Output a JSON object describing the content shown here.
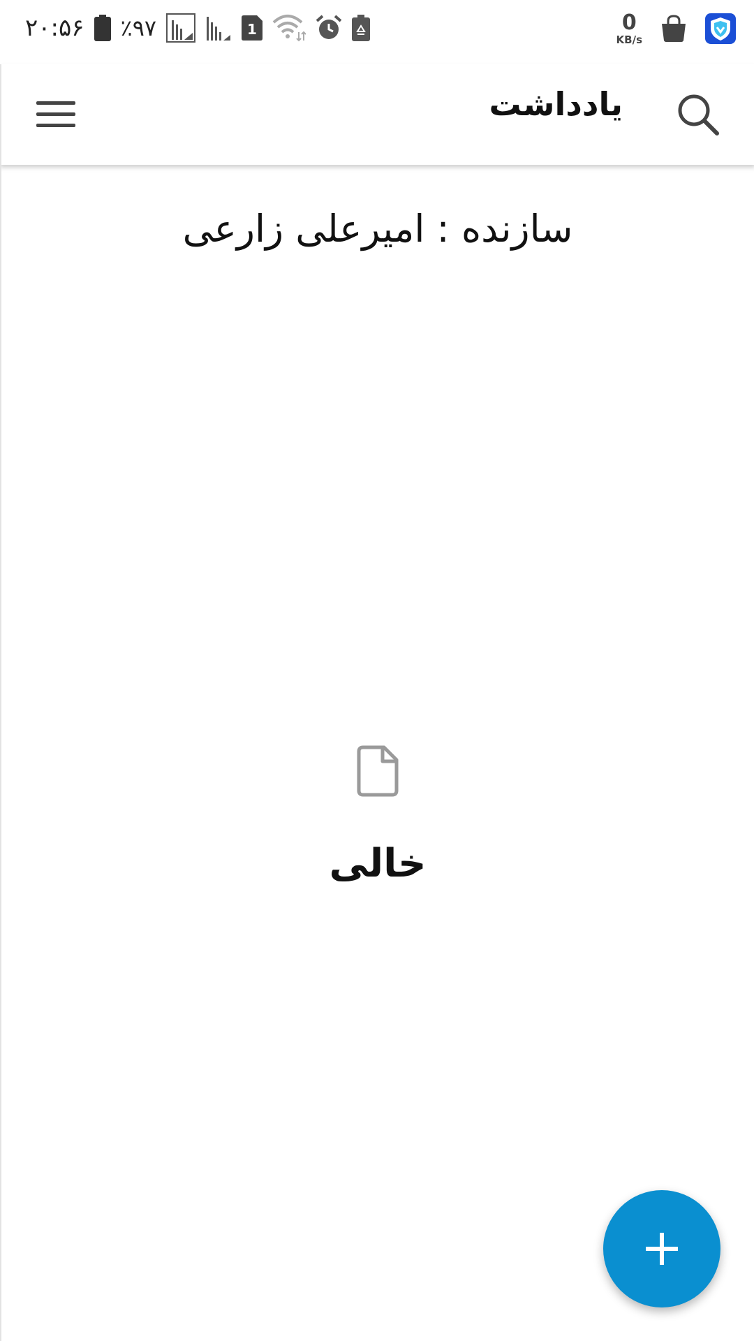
{
  "status_bar": {
    "time": "۲۰:۵۶",
    "battery_percent": "٪۹۷",
    "sim_label": "1",
    "net_speed_value": "0",
    "net_speed_unit": "KB/s",
    "icons": [
      "battery-icon",
      "signal-icon",
      "signal-icon-2",
      "sim-icon",
      "wifi-icon",
      "alarm-icon",
      "recycle-icon",
      "shopping-bag-icon",
      "shield-icon"
    ]
  },
  "app_bar": {
    "title": "یادداشت",
    "menu_icon": "hamburger-menu-icon",
    "search_icon": "search-icon"
  },
  "content": {
    "creator": "سازنده : امیرعلی زارعی",
    "empty_icon": "document-icon",
    "empty_text": "خالی"
  },
  "fab": {
    "icon": "plus-icon",
    "color": "#0a8fd0"
  }
}
